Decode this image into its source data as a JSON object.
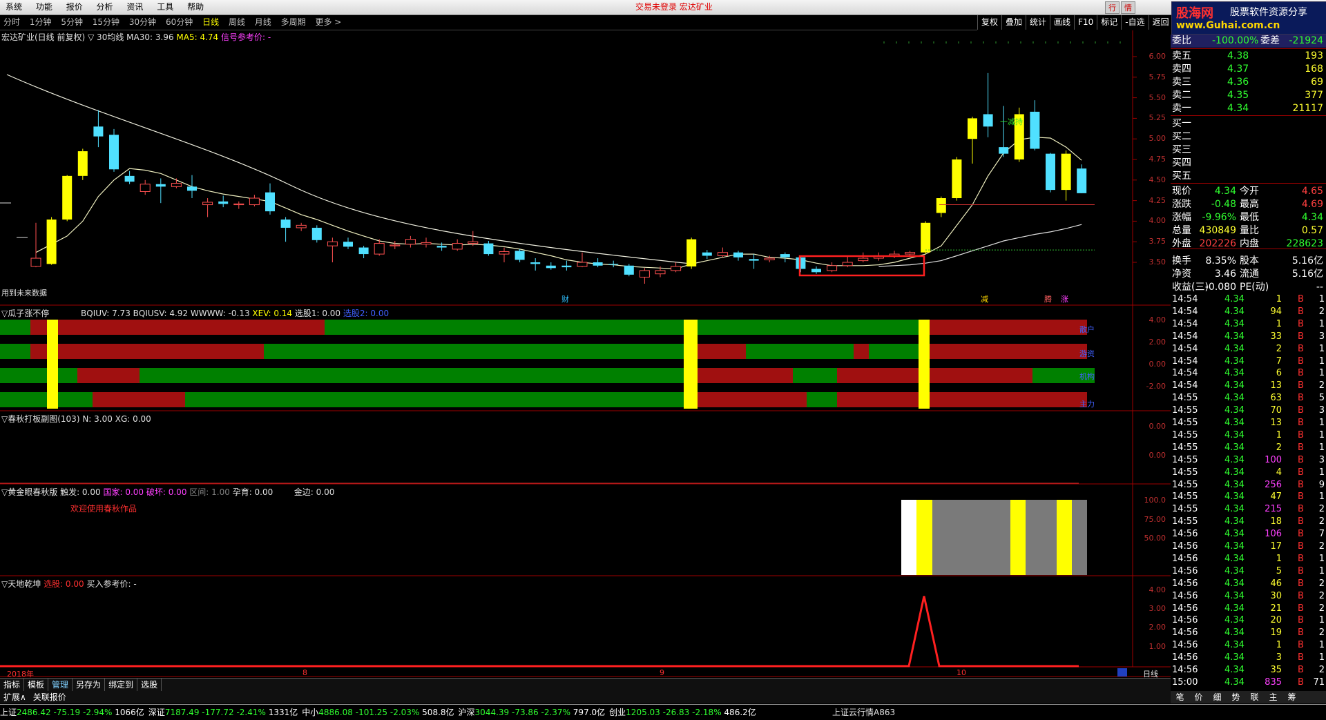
{
  "menu": {
    "items": [
      "系统",
      "功能",
      "报价",
      "分析",
      "资讯",
      "工具",
      "帮助"
    ],
    "center_text": "交易未登录  宏达矿业",
    "right_buttons": [
      "行",
      "情"
    ],
    "logo_line1": "股海网",
    "logo_line1b": "股票软件资源分享",
    "logo_line2": "www.Guhai.com.cn"
  },
  "periods": {
    "items": [
      "分时",
      "1分钟",
      "5分钟",
      "15分钟",
      "30分钟",
      "60分钟",
      "日线",
      "周线",
      "月线",
      "多周期",
      "更多 >"
    ],
    "active": "日线",
    "tools": [
      "复权",
      "叠加",
      "统计",
      "画线",
      "F10",
      "标记",
      "-自选",
      "返回"
    ]
  },
  "main_chart": {
    "title": "宏达矿业(日线 前复权)",
    "ma_label": "▽ 30均线",
    "ma30": "MA30: 3.96",
    "ma5": "MA5: 4.74",
    "signal": "信号参考价: -",
    "note": "用到未来数据",
    "markers": [
      "财",
      "减",
      "腾",
      "涨"
    ],
    "y_ticks": [
      "6.00",
      "5.75",
      "5.50",
      "5.25",
      "5.00",
      "4.75",
      "4.50",
      "4.25",
      "4.00",
      "3.75",
      "3.50"
    ],
    "annotation": "一减持",
    "colors": {
      "up": "#ffff00",
      "down": "#50e0ff",
      "ma": "#e8e8c0"
    }
  },
  "chart_data": {
    "type": "candlestick",
    "title": "宏达矿业(日线 前复权)",
    "ylim": [
      3.3,
      6.1
    ],
    "candles": [
      {
        "o": 3.45,
        "c": 3.55,
        "h": 3.98,
        "l": 3.44
      },
      {
        "o": 3.48,
        "c": 4.02,
        "h": 4.05,
        "l": 3.47
      },
      {
        "o": 4.02,
        "c": 4.55,
        "h": 4.56,
        "l": 4.0
      },
      {
        "o": 4.55,
        "c": 4.85,
        "h": 4.88,
        "l": 4.5
      },
      {
        "o": 5.15,
        "c": 5.03,
        "h": 5.35,
        "l": 4.9
      },
      {
        "o": 5.05,
        "c": 4.63,
        "h": 5.12,
        "l": 4.6
      },
      {
        "o": 4.55,
        "c": 4.48,
        "h": 4.61,
        "l": 4.45
      },
      {
        "o": 4.36,
        "c": 4.45,
        "h": 4.5,
        "l": 4.32
      },
      {
        "o": 4.45,
        "c": 4.42,
        "h": 4.52,
        "l": 4.22
      },
      {
        "o": 4.42,
        "c": 4.46,
        "h": 4.52,
        "l": 4.4
      },
      {
        "o": 4.42,
        "c": 4.37,
        "h": 4.56,
        "l": 4.28
      },
      {
        "o": 4.2,
        "c": 4.23,
        "h": 4.28,
        "l": 4.05
      },
      {
        "o": 4.24,
        "c": 4.21,
        "h": 4.31,
        "l": 4.17
      },
      {
        "o": 4.2,
        "c": 4.21,
        "h": 4.24,
        "l": 4.15
      },
      {
        "o": 4.2,
        "c": 4.28,
        "h": 4.32,
        "l": 4.18
      },
      {
        "o": 4.35,
        "c": 4.12,
        "h": 4.46,
        "l": 4.08
      },
      {
        "o": 4.02,
        "c": 3.92,
        "h": 4.05,
        "l": 3.75
      },
      {
        "o": 3.92,
        "c": 3.95,
        "h": 3.98,
        "l": 3.88
      },
      {
        "o": 3.92,
        "c": 3.77,
        "h": 3.95,
        "l": 3.74
      },
      {
        "o": 3.7,
        "c": 3.75,
        "h": 3.8,
        "l": 3.5
      },
      {
        "o": 3.75,
        "c": 3.69,
        "h": 3.8,
        "l": 3.66
      },
      {
        "o": 3.68,
        "c": 3.6,
        "h": 3.7,
        "l": 3.55
      },
      {
        "o": 3.6,
        "c": 3.73,
        "h": 3.78,
        "l": 3.58
      },
      {
        "o": 3.7,
        "c": 3.71,
        "h": 3.76,
        "l": 3.66
      },
      {
        "o": 3.72,
        "c": 3.78,
        "h": 3.82,
        "l": 3.68
      },
      {
        "o": 3.72,
        "c": 3.74,
        "h": 3.8,
        "l": 3.68
      },
      {
        "o": 3.7,
        "c": 3.68,
        "h": 3.74,
        "l": 3.64
      },
      {
        "o": 3.66,
        "c": 3.73,
        "h": 3.78,
        "l": 3.64
      },
      {
        "o": 3.73,
        "c": 3.75,
        "h": 3.88,
        "l": 3.7
      },
      {
        "o": 3.73,
        "c": 3.6,
        "h": 3.76,
        "l": 3.58
      },
      {
        "o": 3.6,
        "c": 3.63,
        "h": 3.68,
        "l": 3.5
      },
      {
        "o": 3.64,
        "c": 3.53,
        "h": 3.66,
        "l": 3.5
      },
      {
        "o": 3.5,
        "c": 3.48,
        "h": 3.55,
        "l": 3.4
      },
      {
        "o": 3.46,
        "c": 3.43,
        "h": 3.5,
        "l": 3.41
      },
      {
        "o": 3.46,
        "c": 3.44,
        "h": 3.52,
        "l": 3.4
      },
      {
        "o": 3.45,
        "c": 3.5,
        "h": 3.62,
        "l": 3.44
      },
      {
        "o": 3.5,
        "c": 3.46,
        "h": 3.55,
        "l": 3.44
      },
      {
        "o": 3.48,
        "c": 3.47,
        "h": 3.52,
        "l": 3.44
      },
      {
        "o": 3.46,
        "c": 3.35,
        "h": 3.48,
        "l": 3.33
      },
      {
        "o": 3.32,
        "c": 3.4,
        "h": 3.43,
        "l": 3.24
      },
      {
        "o": 3.36,
        "c": 3.4,
        "h": 3.45,
        "l": 3.32
      },
      {
        "o": 3.4,
        "c": 3.45,
        "h": 3.5,
        "l": 3.38
      },
      {
        "o": 3.45,
        "c": 3.78,
        "h": 3.8,
        "l": 3.42
      },
      {
        "o": 3.62,
        "c": 3.58,
        "h": 3.65,
        "l": 3.54
      },
      {
        "o": 3.58,
        "c": 3.62,
        "h": 3.68,
        "l": 3.56
      },
      {
        "o": 3.62,
        "c": 3.56,
        "h": 3.64,
        "l": 3.52
      },
      {
        "o": 3.54,
        "c": 3.52,
        "h": 3.6,
        "l": 3.42
      },
      {
        "o": 3.53,
        "c": 3.55,
        "h": 3.58,
        "l": 3.5
      },
      {
        "o": 3.6,
        "c": 3.56,
        "h": 3.62,
        "l": 3.5
      },
      {
        "o": 3.56,
        "c": 3.42,
        "h": 3.58,
        "l": 3.38
      },
      {
        "o": 3.42,
        "c": 3.38,
        "h": 3.45,
        "l": 3.36
      },
      {
        "o": 3.4,
        "c": 3.46,
        "h": 3.5,
        "l": 3.38
      },
      {
        "o": 3.46,
        "c": 3.5,
        "h": 3.58,
        "l": 3.44
      },
      {
        "o": 3.52,
        "c": 3.55,
        "h": 3.62,
        "l": 3.5
      },
      {
        "o": 3.55,
        "c": 3.58,
        "h": 3.62,
        "l": 3.52
      },
      {
        "o": 3.58,
        "c": 3.6,
        "h": 3.64,
        "l": 3.55
      },
      {
        "o": 3.6,
        "c": 3.62,
        "h": 3.64,
        "l": 3.58
      },
      {
        "o": 3.62,
        "c": 3.98,
        "h": 4.0,
        "l": 3.6
      },
      {
        "o": 4.1,
        "c": 4.28,
        "h": 4.3,
        "l": 4.05
      },
      {
        "o": 4.28,
        "c": 4.75,
        "h": 4.78,
        "l": 4.25
      },
      {
        "o": 5.0,
        "c": 5.25,
        "h": 5.27,
        "l": 4.7
      },
      {
        "o": 5.3,
        "c": 5.15,
        "h": 5.8,
        "l": 5.02
      },
      {
        "o": 4.9,
        "c": 4.82,
        "h": 5.4,
        "l": 4.78
      },
      {
        "o": 4.75,
        "c": 5.3,
        "h": 5.38,
        "l": 4.72
      },
      {
        "o": 5.33,
        "c": 4.88,
        "h": 5.47,
        "l": 4.86
      },
      {
        "o": 4.82,
        "c": 4.38,
        "h": 4.83,
        "l": 4.35
      },
      {
        "o": 4.38,
        "c": 4.82,
        "h": 4.86,
        "l": 4.25
      },
      {
        "o": 4.64,
        "c": 4.34,
        "h": 4.69,
        "l": 4.34
      }
    ],
    "ma5": [
      3.62,
      3.72,
      3.82,
      4.0,
      4.3,
      4.5,
      4.64,
      4.62,
      4.58,
      4.5,
      4.42,
      4.37,
      4.33,
      4.3,
      4.27,
      4.24,
      4.16,
      4.08,
      4.02,
      3.95,
      3.88,
      3.82,
      3.76,
      3.73,
      3.72,
      3.73,
      3.72,
      3.71,
      3.72,
      3.71,
      3.69,
      3.66,
      3.62,
      3.58,
      3.53,
      3.5,
      3.48,
      3.47,
      3.45,
      3.44,
      3.43,
      3.42,
      3.48,
      3.52,
      3.56,
      3.6,
      3.6,
      3.56,
      3.55,
      3.53,
      3.49,
      3.46,
      3.46,
      3.46,
      3.47,
      3.5,
      3.55,
      3.6,
      3.7,
      3.95,
      4.2,
      4.55,
      4.83,
      4.99,
      5.02,
      5.01,
      4.9,
      4.74
    ],
    "ma30": [
      null,
      null,
      null,
      null,
      null,
      null,
      null,
      null,
      null,
      null,
      null,
      null,
      null,
      null,
      null,
      null,
      null,
      null,
      null,
      null,
      null,
      null,
      null,
      null,
      null,
      null,
      null,
      null,
      null,
      null,
      null,
      null,
      null,
      null,
      null,
      null,
      null,
      null,
      null,
      null,
      null,
      null,
      null,
      null,
      null,
      null,
      null,
      null,
      null,
      null,
      null,
      null,
      null,
      null,
      3.45,
      3.46,
      3.47,
      3.49,
      3.52,
      3.58,
      3.64,
      3.7,
      3.76,
      3.8,
      3.84,
      3.87,
      3.91,
      3.96
    ],
    "ma_long_start": 5.92,
    "series": [
      {
        "name": "MA5"
      },
      {
        "name": "MA30"
      }
    ]
  },
  "panel2": {
    "title": "▽瓜子涨不停",
    "bqiuv": "BQIUV: 7.73",
    "bqiusv": "BQIUSV: 4.92",
    "www": "WWWW: -0.13",
    "xev": "XEV: 0.14",
    "sel1": "选股1: 0.00",
    "sel2": "选股2: 0.00",
    "y_ticks": [
      "4.00",
      "2.00",
      "0.00",
      "-2.00"
    ],
    "row_labels": [
      "散户",
      "游资",
      "机构",
      "主力"
    ]
  },
  "panel3": {
    "title": "▽春秋打板副图(103)",
    "n": "N: 3.00",
    "xg": "XG: 0.00",
    "y_ticks": [
      "0.00",
      "0.00"
    ]
  },
  "panel4": {
    "title": "▽黄金眼春秋版",
    "chufa": "触发: 0.00",
    "guojia": "国家: 0.00",
    "pohuai": "破坏: 0.00",
    "qujian": "区间: 1.00",
    "yunyu": "孕育: 0.00",
    "jinbian": "金边: 0.00",
    "welcome": "欢迎使用春秋作品",
    "y_ticks": [
      "100.0",
      "75.00",
      "50.00"
    ]
  },
  "panel5": {
    "title": "▽天地乾坤",
    "xuangu": "选股: 0.00",
    "buy_ref": "买入参考价: -",
    "y_ticks": [
      "4.00",
      "3.00",
      "2.00",
      "1.00"
    ],
    "spike_value": 4.0
  },
  "x_axis": {
    "labels": [
      "2018年",
      "8",
      "9",
      "10"
    ],
    "period": "日线"
  },
  "order_book": {
    "header": [
      {
        "label": "委比",
        "value": "-100.00%"
      },
      {
        "label": "委差",
        "value": "-21924"
      }
    ],
    "asks": [
      {
        "label": "卖五",
        "price": "4.38",
        "vol": "193"
      },
      {
        "label": "卖四",
        "price": "4.37",
        "vol": "168"
      },
      {
        "label": "卖三",
        "price": "4.36",
        "vol": "69"
      },
      {
        "label": "卖二",
        "price": "4.35",
        "vol": "377"
      },
      {
        "label": "卖一",
        "price": "4.34",
        "vol": "21117"
      }
    ],
    "bids": [
      "买一",
      "买二",
      "买三",
      "买四",
      "买五"
    ],
    "quote": [
      {
        "l1": "现价",
        "v1": "4.34",
        "l2": "今开",
        "v2": "4.65"
      },
      {
        "l1": "涨跌",
        "v1": "-0.48",
        "l2": "最高",
        "v2": "4.69"
      },
      {
        "l1": "涨幅",
        "v1": "-9.96%",
        "l2": "最低",
        "v2": "4.34"
      },
      {
        "l1": "总量",
        "v1": "430849",
        "l2": "量比",
        "v2": "0.57"
      },
      {
        "l1": "外盘",
        "v1": "202226",
        "l2": "内盘",
        "v2": "228623"
      },
      {
        "l1": "换手",
        "v1": "8.35%",
        "l2": "股本",
        "v2": "5.16亿"
      },
      {
        "l1": "净资",
        "v1": "3.46",
        "l2": "流通",
        "v2": "5.16亿"
      },
      {
        "l1": "收益(三)",
        "v1": "-0.080",
        "l2": "PE(动)",
        "v2": "--"
      }
    ]
  },
  "ticks": [
    {
      "t": "14:54",
      "p": "4.34",
      "v": "1",
      "s": "B",
      "n": "1"
    },
    {
      "t": "14:54",
      "p": "4.34",
      "v": "94",
      "s": "B",
      "n": "2"
    },
    {
      "t": "14:54",
      "p": "4.34",
      "v": "1",
      "s": "B",
      "n": "1"
    },
    {
      "t": "14:54",
      "p": "4.34",
      "v": "33",
      "s": "B",
      "n": "3"
    },
    {
      "t": "14:54",
      "p": "4.34",
      "v": "2",
      "s": "B",
      "n": "1"
    },
    {
      "t": "14:54",
      "p": "4.34",
      "v": "7",
      "s": "B",
      "n": "1"
    },
    {
      "t": "14:54",
      "p": "4.34",
      "v": "6",
      "s": "B",
      "n": "1"
    },
    {
      "t": "14:54",
      "p": "4.34",
      "v": "13",
      "s": "B",
      "n": "2"
    },
    {
      "t": "14:55",
      "p": "4.34",
      "v": "63",
      "s": "B",
      "n": "5"
    },
    {
      "t": "14:55",
      "p": "4.34",
      "v": "70",
      "s": "B",
      "n": "3"
    },
    {
      "t": "14:55",
      "p": "4.34",
      "v": "13",
      "s": "B",
      "n": "1"
    },
    {
      "t": "14:55",
      "p": "4.34",
      "v": "1",
      "s": "B",
      "n": "1"
    },
    {
      "t": "14:55",
      "p": "4.34",
      "v": "2",
      "s": "B",
      "n": "1"
    },
    {
      "t": "14:55",
      "p": "4.34",
      "v": "100",
      "s": "B",
      "n": "3"
    },
    {
      "t": "14:55",
      "p": "4.34",
      "v": "4",
      "s": "B",
      "n": "1"
    },
    {
      "t": "14:55",
      "p": "4.34",
      "v": "256",
      "s": "B",
      "n": "9"
    },
    {
      "t": "14:55",
      "p": "4.34",
      "v": "47",
      "s": "B",
      "n": "1"
    },
    {
      "t": "14:55",
      "p": "4.34",
      "v": "215",
      "s": "B",
      "n": "2"
    },
    {
      "t": "14:55",
      "p": "4.34",
      "v": "18",
      "s": "B",
      "n": "2"
    },
    {
      "t": "14:56",
      "p": "4.34",
      "v": "106",
      "s": "B",
      "n": "7"
    },
    {
      "t": "14:56",
      "p": "4.34",
      "v": "17",
      "s": "B",
      "n": "2"
    },
    {
      "t": "14:56",
      "p": "4.34",
      "v": "1",
      "s": "B",
      "n": "1"
    },
    {
      "t": "14:56",
      "p": "4.34",
      "v": "5",
      "s": "B",
      "n": "1"
    },
    {
      "t": "14:56",
      "p": "4.34",
      "v": "46",
      "s": "B",
      "n": "2"
    },
    {
      "t": "14:56",
      "p": "4.34",
      "v": "30",
      "s": "B",
      "n": "2"
    },
    {
      "t": "14:56",
      "p": "4.34",
      "v": "21",
      "s": "B",
      "n": "2"
    },
    {
      "t": "14:56",
      "p": "4.34",
      "v": "20",
      "s": "B",
      "n": "1"
    },
    {
      "t": "14:56",
      "p": "4.34",
      "v": "19",
      "s": "B",
      "n": "2"
    },
    {
      "t": "14:56",
      "p": "4.34",
      "v": "1",
      "s": "B",
      "n": "1"
    },
    {
      "t": "14:56",
      "p": "4.34",
      "v": "3",
      "s": "B",
      "n": "1"
    },
    {
      "t": "14:56",
      "p": "4.34",
      "v": "35",
      "s": "B",
      "n": "2"
    },
    {
      "t": "15:00",
      "p": "4.34",
      "v": "835",
      "s": "B",
      "n": "71"
    }
  ],
  "bottom_tabs": [
    "指标",
    "模板",
    "管理",
    "另存为",
    "绑定到",
    "选股"
  ],
  "bottom_tabs2": [
    "扩展∧",
    "关联报价"
  ],
  "right_tabs": [
    "笔",
    "价",
    "细",
    "势",
    "联",
    "主",
    "筹"
  ],
  "status": [
    {
      "name": "上证",
      "val": "2486.42",
      "chg": "-75.19",
      "pct": "-2.94%",
      "amt": "1066亿"
    },
    {
      "name": "深证",
      "val": "7187.49",
      "chg": "-177.72",
      "pct": "-2.41%",
      "amt": "1331亿"
    },
    {
      "name": "中小",
      "val": "4886.08",
      "chg": "-101.25",
      "pct": "-2.03%",
      "amt": "508.8亿"
    },
    {
      "name": "沪深",
      "val": "3044.39",
      "chg": "-73.86",
      "pct": "-2.37%",
      "amt": "797.0亿"
    },
    {
      "name": "创业",
      "val": "1205.03",
      "chg": "-26.83",
      "pct": "-2.18%",
      "amt": "486.2亿"
    }
  ],
  "status_right": "上证云行情A863"
}
